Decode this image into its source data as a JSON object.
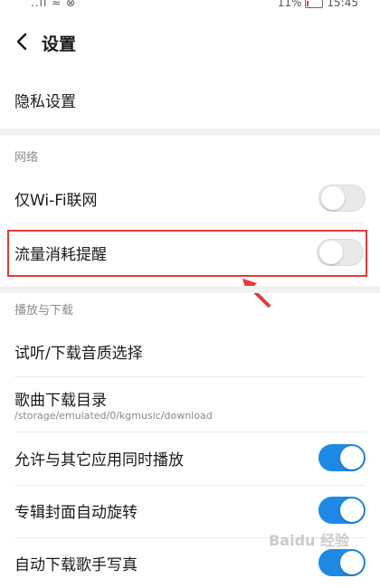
{
  "status": {
    "time": "15:45",
    "battery": "11%",
    "signal": "..ll ≈ ⊗"
  },
  "header": {
    "title": "设置"
  },
  "privacy": {
    "label": "隐私设置"
  },
  "network": {
    "section_label": "网络",
    "wifi_only": {
      "label": "仅Wi-Fi联网",
      "on": false
    },
    "data_alert": {
      "label": "流量消耗提醒",
      "on": false
    }
  },
  "download": {
    "section_label": "播放与下载",
    "quality": {
      "label": "试听/下载音质选择"
    },
    "dir": {
      "label": "歌曲下载目录",
      "path": "/storage/emulated/0/kgmusic/download"
    },
    "concurrent": {
      "label": "允许与其它应用同时播放",
      "on": true
    },
    "cover_rotate": {
      "label": "专辑封面自动旋转",
      "on": true
    },
    "auto_photo": {
      "label": "自动下载歌手写真",
      "on": true
    }
  },
  "colors": {
    "accent": "#1e88e5",
    "highlight": "#e53935"
  },
  "watermark": "Baidu 经验"
}
